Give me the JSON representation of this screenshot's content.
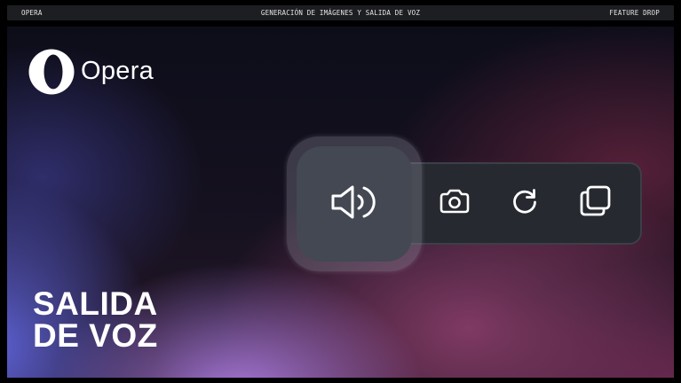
{
  "top_bar": {
    "left": "OPERA",
    "center": "GENERACIÓN DE IMÁGENES Y SALIDA DE VOZ",
    "right": "FEATURE DROP"
  },
  "logo": {
    "text": "Opera",
    "icon": "opera-logo-icon"
  },
  "headline": {
    "line1": "SALIDA",
    "line2": "DE VOZ"
  },
  "toolbar": {
    "buttons": [
      {
        "name": "speaker",
        "icon": "speaker-icon",
        "state": "highlighted"
      },
      {
        "name": "camera",
        "icon": "camera-icon"
      },
      {
        "name": "refresh",
        "icon": "refresh-icon"
      },
      {
        "name": "copy",
        "icon": "copy-icon"
      }
    ]
  },
  "colors": {
    "top_bar_bg": "#1d1e22",
    "toolbar_bg": "#262930",
    "highlight_btn_bg": "#434852",
    "text": "#ffffff",
    "gradient_purple": "#b280e8",
    "gradient_blue": "#6066e0",
    "gradient_magenta": "#a04678"
  }
}
